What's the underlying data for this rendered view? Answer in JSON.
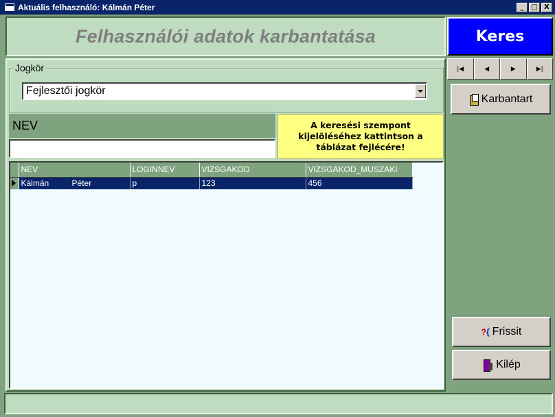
{
  "window": {
    "title": "Aktuális felhasználó: Kálmán Péter",
    "buttons": {
      "minimize": "_",
      "maximize": "□",
      "close": "X"
    }
  },
  "header": {
    "title": "Felhasználói adatok karbantatása"
  },
  "keres_button": "Keres",
  "jogkor": {
    "legend": "Jogkör",
    "selected": "Fejlesztői jogkör"
  },
  "search": {
    "field_label": "NEV",
    "value": "",
    "hint": "A keresési szempont kijelöléséhez kattintson a táblázat fejlécére!"
  },
  "grid": {
    "columns": [
      "NEV",
      "LOGINNEV",
      "VIZSGAKOD",
      "VIZSGAKOD_MUSZAKI"
    ],
    "rows": [
      {
        "nev": "Kálmán          Péter",
        "loginnev": "p",
        "vizsgakod": "123",
        "vizsgakod_muszaki": "456"
      }
    ]
  },
  "navigator": {
    "first": "|◀",
    "prev": "◀",
    "next": "▶",
    "last": "▶|"
  },
  "side_buttons": {
    "karbantart": "Karbantart",
    "frissit": "Frissit",
    "kilep": "Kilép"
  },
  "colors": {
    "background": "#7fa37f",
    "panel": "#c0dcc0",
    "keres_button": "#0000ff",
    "selection": "#0a246a",
    "hint": "#ffff80",
    "grid_bg": "#f0fbff"
  },
  "icons": {
    "karbantart": "edit-document-icon",
    "frissit": "refresh-icon",
    "kilep": "exit-door-icon"
  }
}
